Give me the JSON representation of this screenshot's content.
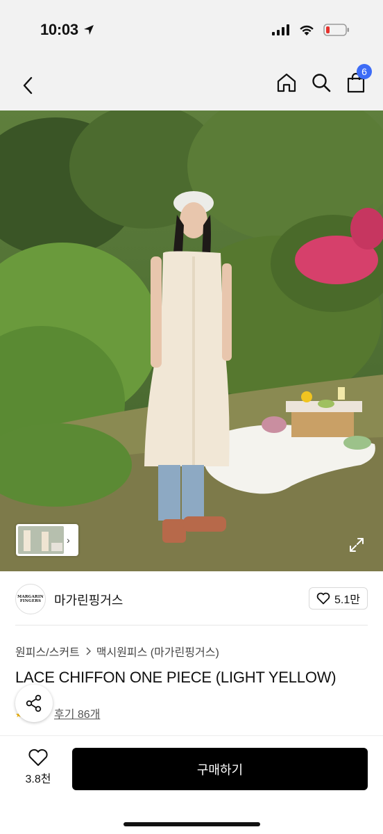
{
  "status": {
    "time": "10:03",
    "icons": [
      "location-arrow-icon",
      "cellular-signal-icon",
      "wifi-icon",
      "battery-low-icon"
    ]
  },
  "nav": {
    "back_icon": "chevron-left-icon",
    "home_icon": "home-icon",
    "search_icon": "search-icon",
    "cart_icon": "shopping-bag-icon",
    "cart_count": "6",
    "badge_color": "#3d6cf6"
  },
  "photo": {
    "thumb_arrow": "›",
    "expand_icon": "expand-icon"
  },
  "brand": {
    "logo_line1": "MARGARIN",
    "logo_line2": "FINGERS",
    "name": "마가린핑거스",
    "like_count": "5.1만"
  },
  "product": {
    "category": "원피스/스커트",
    "subcategory": "맥시원피스 (마가린핑거스)",
    "title": "LACE CHIFFON ONE PIECE (LIGHT YELLOW)",
    "review_label": "후기 86개"
  },
  "bottom": {
    "wish_count": "3.8천",
    "buy_label": "구매하기"
  }
}
